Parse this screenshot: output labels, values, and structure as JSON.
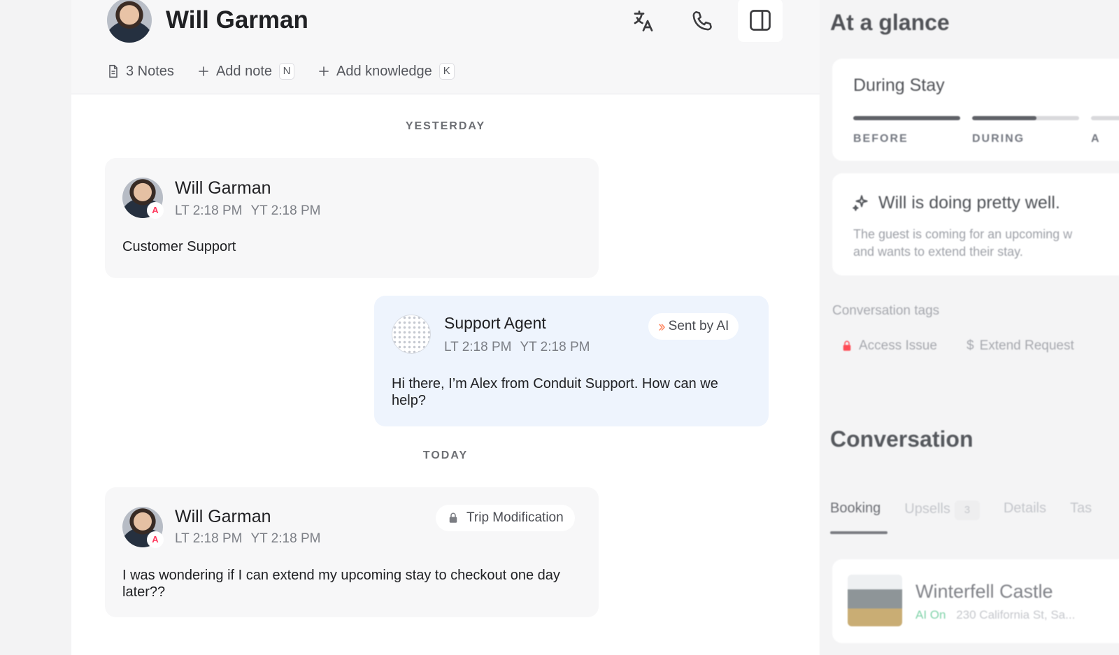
{
  "contact": {
    "name": "Will Garman"
  },
  "header_actions": {
    "translate": "translate-icon",
    "call": "phone-icon",
    "panel": "sidebar-panel-icon"
  },
  "subbar": {
    "notes": "3 Notes",
    "add_note": "Add note",
    "add_note_key": "N",
    "add_knowledge": "Add knowledge",
    "add_knowledge_key": "K"
  },
  "timeline": {
    "yesterday": "YESTERDAY",
    "today": "TODAY"
  },
  "messages": [
    {
      "author": "Will Garman",
      "local_time": "LT 2:18 PM",
      "your_time": "YT 2:18 PM",
      "text": "Customer Support"
    },
    {
      "author": "Support Agent",
      "local_time": "LT 2:18 PM",
      "your_time": "YT 2:18 PM",
      "badge": "Sent by AI",
      "text": "Hi there, I’m Alex from Conduit Support. How can we help?"
    },
    {
      "author": "Will Garman",
      "local_time": "LT 2:18 PM",
      "your_time": "YT 2:18 PM",
      "tag": "Trip Modification",
      "text": "I was wondering if I can extend my upcoming stay to checkout one day later??"
    }
  ],
  "at_a_glance": {
    "title": "At a glance",
    "stage": {
      "title": "During Stay",
      "before": "BEFORE",
      "during": "DURING",
      "after": "A",
      "before_progress": 1,
      "during_progress": 0.6
    },
    "summary": {
      "title": "Will is doing pretty well.",
      "line1": "The guest is coming for an upcoming w",
      "line2": "and wants to extend their stay."
    },
    "tags_label": "Conversation tags",
    "tags": [
      "Access Issue",
      "Extend Request"
    ]
  },
  "conversation_panel": {
    "title": "Conversation",
    "tabs": [
      "Booking",
      "Upsells",
      "Details",
      "Tas"
    ],
    "upsell_count": "3",
    "property": {
      "name": "Winterfell Castle",
      "status": "AI On",
      "address": "230 California St, Sa..."
    }
  },
  "colors": {
    "agent_bubble": "#eef4fd",
    "airbnb": "#ff385c",
    "access_issue": "#ff4b55"
  }
}
